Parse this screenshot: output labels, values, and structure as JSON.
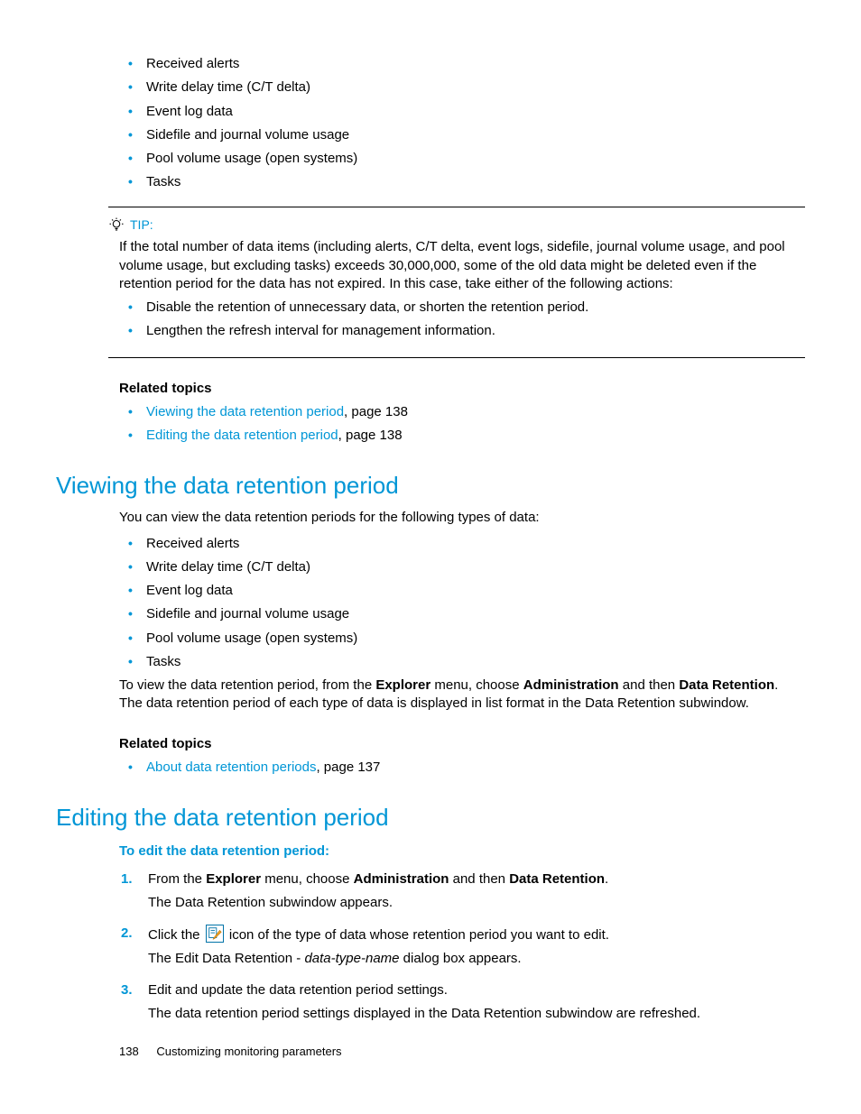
{
  "topList": [
    "Received alerts",
    "Write delay time (C/T delta)",
    "Event log data",
    "Sidefile and journal volume usage",
    "Pool volume usage (open systems)",
    "Tasks"
  ],
  "tip": {
    "label": "TIP:",
    "para": "If the total number of data items (including alerts, C/T delta, event logs, sidefile, journal volume usage, and pool volume usage, but excluding tasks) exceeds 30,000,000, some of the old data might be deleted even if the retention period for the data has not expired. In this case, take either of the following actions:",
    "bullets": [
      "Disable the retention of unnecessary data, or shorten the retention period.",
      "Lengthen the refresh interval for management information."
    ]
  },
  "related1": {
    "heading": "Related topics",
    "items": [
      {
        "link": "Viewing the data retention period",
        "suffix": ", page 138"
      },
      {
        "link": "Editing the data retention period",
        "suffix": ", page 138"
      }
    ]
  },
  "section1": {
    "title": "Viewing the data retention period",
    "intro": "You can view the data retention periods for the following types of data:",
    "list": [
      "Received alerts",
      "Write delay time (C/T delta)",
      "Event log data",
      "Sidefile and journal volume usage",
      "Pool volume usage (open systems)",
      "Tasks"
    ],
    "para_pre": "To view the data retention period, from the ",
    "b1": "Explorer",
    "mid1": " menu, choose ",
    "b2": "Administration",
    "mid2": " and then ",
    "b3": "Data Retention",
    "para_post": ". The data retention period of each type of data is displayed in list format in the Data Retention subwindow.",
    "relatedHeading": "Related topics",
    "relatedItems": [
      {
        "link": "About data retention periods",
        "suffix": ", page 137"
      }
    ]
  },
  "section2": {
    "title": "Editing the data retention period",
    "procHeading": "To edit the data retention period:",
    "step1": {
      "num": "1.",
      "pre": "From the ",
      "b1": "Explorer",
      "mid1": " menu, choose ",
      "b2": "Administration",
      "mid2": " and then ",
      "b3": "Data Retention",
      "post": ".",
      "sub": "The Data Retention subwindow appears."
    },
    "step2": {
      "num": "2.",
      "pre": "Click the ",
      "post": " icon of the type of data whose retention period you want to edit.",
      "sub_pre": "The Edit Data Retention - ",
      "sub_it": "data-type-name",
      "sub_post": " dialog box appears."
    },
    "step3": {
      "num": "3.",
      "line": "Edit and update the data retention period settings.",
      "sub": "The data retention period settings displayed in the Data Retention subwindow are refreshed."
    }
  },
  "footer": {
    "page": "138",
    "chapter": "Customizing monitoring parameters"
  }
}
